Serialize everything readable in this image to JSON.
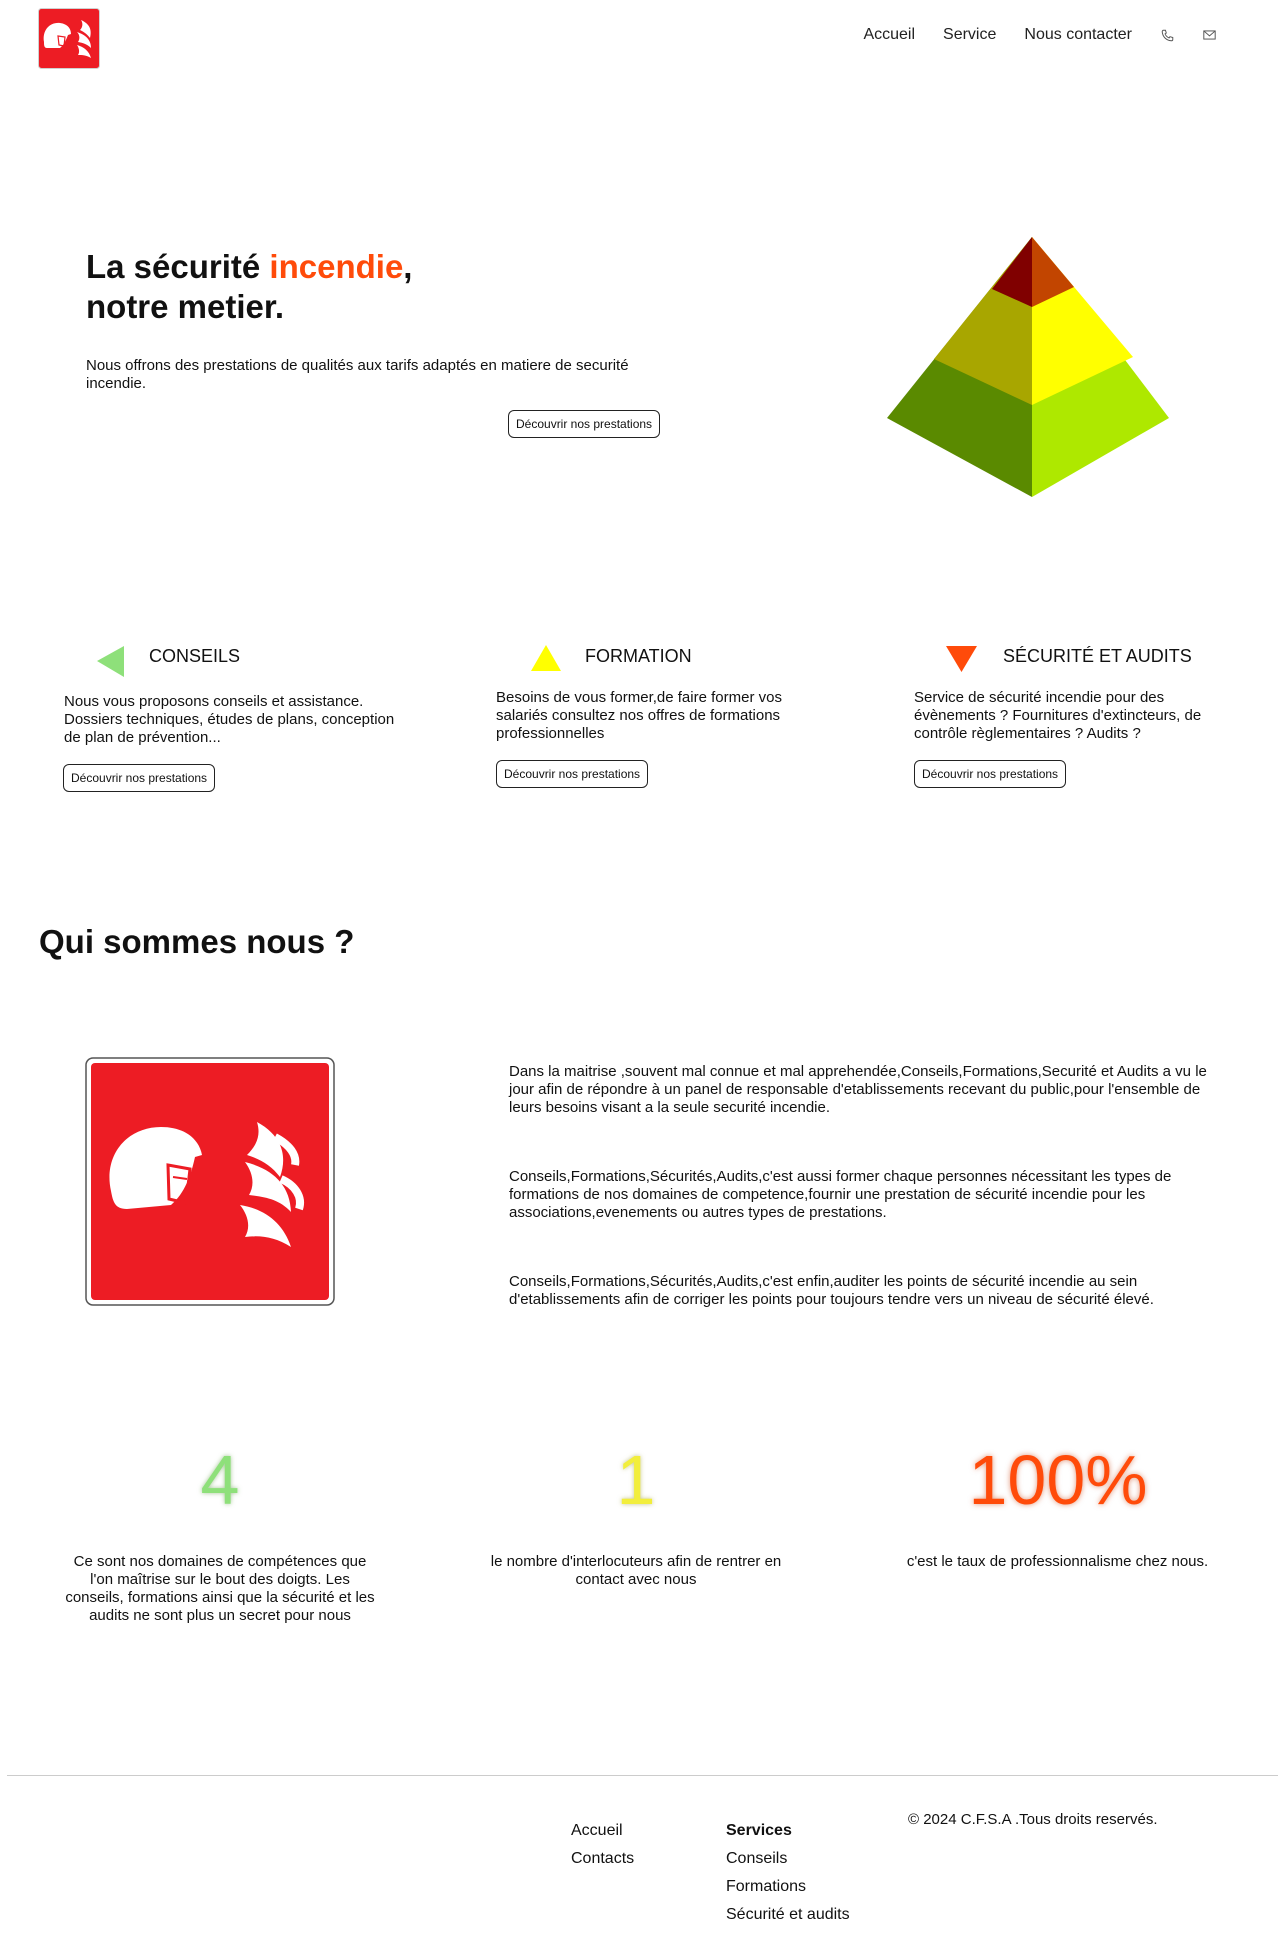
{
  "header": {
    "logo_icon": "fire-helmet-icon",
    "nav": [
      "Accueil",
      "Service",
      "Nous contacter"
    ],
    "phone_icon": "phone-icon",
    "mail_icon": "mail-icon"
  },
  "hero": {
    "title_pre": "La sécurité ",
    "title_accent": "incendie",
    "title_comma": ",",
    "title_line2": "notre metier.",
    "description": "Nous offrons des prestations de qualités aux tarifs adaptés en matiere de securité incendie.",
    "button": "Découvrir nos prestations",
    "accent_color": "#ff4b0a"
  },
  "features": [
    {
      "icon": "green-triangle-left-icon",
      "title": "CONSEILS",
      "description": "Nous vous proposons conseils et assistance. Dossiers techniques, études de plans, conception de plan de prévention...",
      "button": "Découvrir nos prestations"
    },
    {
      "icon": "yellow-triangle-up-icon",
      "title": "FORMATION",
      "description": "Besoins de vous former,de faire former vos salariés consultez nos offres de formations professionnelles",
      "button": "Découvrir nos prestations"
    },
    {
      "icon": "orange-triangle-down-icon",
      "title": "SÉCURITÉ ET AUDITS",
      "description": "Service de sécurité incendie pour des évènements ? Fournitures d'extincteurs, de contrôle règlementaires ? Audits ?",
      "button": "Découvrir nos prestations"
    }
  ],
  "about": {
    "title": "Qui sommes nous ?",
    "paragraphs": [
      "Dans la maitrise ,souvent mal connue et mal apprehendée,Conseils,Formations,Securité et Audits a vu le jour afin de répondre à un panel de responsable d'etablissements recevant du public,pour l'ensemble de leurs besoins visant a la seule securité incendie.",
      "Conseils,Formations,Sécurités,Audits,c'est aussi former chaque personnes nécessitant les types de formations de nos domaines de competence,fournir une prestation de sécurité incendie pour les associations,evenements ou autres types de prestations.",
      "Conseils,Formations,Sécurités,Audits,c'est enfin,auditer les points de sécurité incendie au sein d'etablissements afin de corriger les points pour toujours tendre vers un niveau de sécurité élevé."
    ]
  },
  "stats": [
    {
      "value": "4",
      "text": "Ce sont nos domaines de compétences que l'on maîtrise sur le bout des doigts. Les conseils, formations ainsi que la sécurité et les audits ne sont plus un secret pour nous",
      "color": "#8ee07a"
    },
    {
      "value": "1",
      "text": "le nombre d'interlocuteurs afin de rentrer en contact avec nous",
      "color": "#f2ee3c"
    },
    {
      "value": "100%",
      "text": "c'est le taux de professionnalisme chez nous.",
      "color": "#ff4b0a"
    }
  ],
  "footer": {
    "links": [
      "Accueil",
      "Contacts"
    ],
    "services_title": "Services",
    "services": [
      "Conseils",
      "Formations",
      "Sécurité et audits"
    ],
    "copyright": "© 2024 C.F.S.A .Tous droits reservés."
  }
}
